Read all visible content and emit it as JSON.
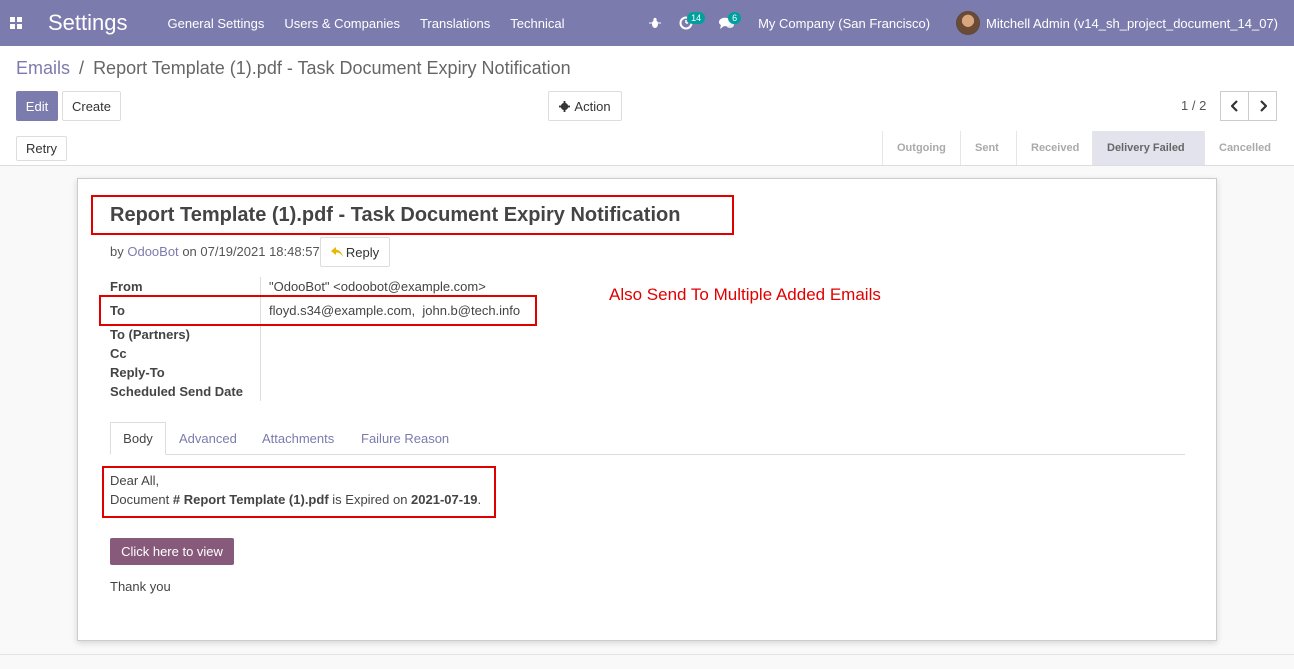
{
  "navbar": {
    "apps_icon": "grid-icon",
    "brand": "Settings",
    "menu": [
      "General Settings",
      "Users & Companies",
      "Translations",
      "Technical"
    ],
    "bug_icon": "bug-icon",
    "activity_count": "14",
    "messages_count": "6",
    "company": "My Company (San Francisco)",
    "user": "Mitchell Admin (v14_sh_project_document_14_07)",
    "color": "#7c7bad"
  },
  "breadcrumb": {
    "parent": "Emails",
    "separator": "/",
    "current": "Report Template (1).pdf - Task Document Expiry Notification"
  },
  "buttons": {
    "edit": "Edit",
    "create": "Create",
    "action": "Action",
    "retry": "Retry"
  },
  "pager": {
    "value": "1 / 2"
  },
  "status": {
    "steps": [
      "Outgoing",
      "Sent",
      "Received",
      "Delivery Failed",
      "Cancelled"
    ],
    "active": "Delivery Failed"
  },
  "email": {
    "subject": "Report Template (1).pdf - Task Document Expiry Notification",
    "by_prefix": "by",
    "author": "OdooBot",
    "on_prefix": "on",
    "date": "07/19/2021 18:48:57",
    "reply_label": "Reply",
    "fields": {
      "from_label": "From",
      "from_value": "\"OdooBot\" <odoobot@example.com>",
      "to_label": "To",
      "to_value": "floyd.s34@example.com,  john.b@tech.info",
      "to_partners_label": "To (Partners)",
      "cc_label": "Cc",
      "reply_to_label": "Reply-To",
      "scheduled_label": "Scheduled Send Date"
    },
    "annotation": "Also Send To Multiple Added Emails",
    "tabs": [
      "Body",
      "Advanced",
      "Attachments",
      "Failure Reason"
    ],
    "body": {
      "greeting": "Dear All,",
      "line_prefix": "Document ",
      "doc_name": "# Report Template (1).pdf",
      "mid": " is Expired on ",
      "expiry": "2021-07-19",
      "suffix": ".",
      "button": "Click here to view",
      "closing": "Thank you"
    }
  }
}
